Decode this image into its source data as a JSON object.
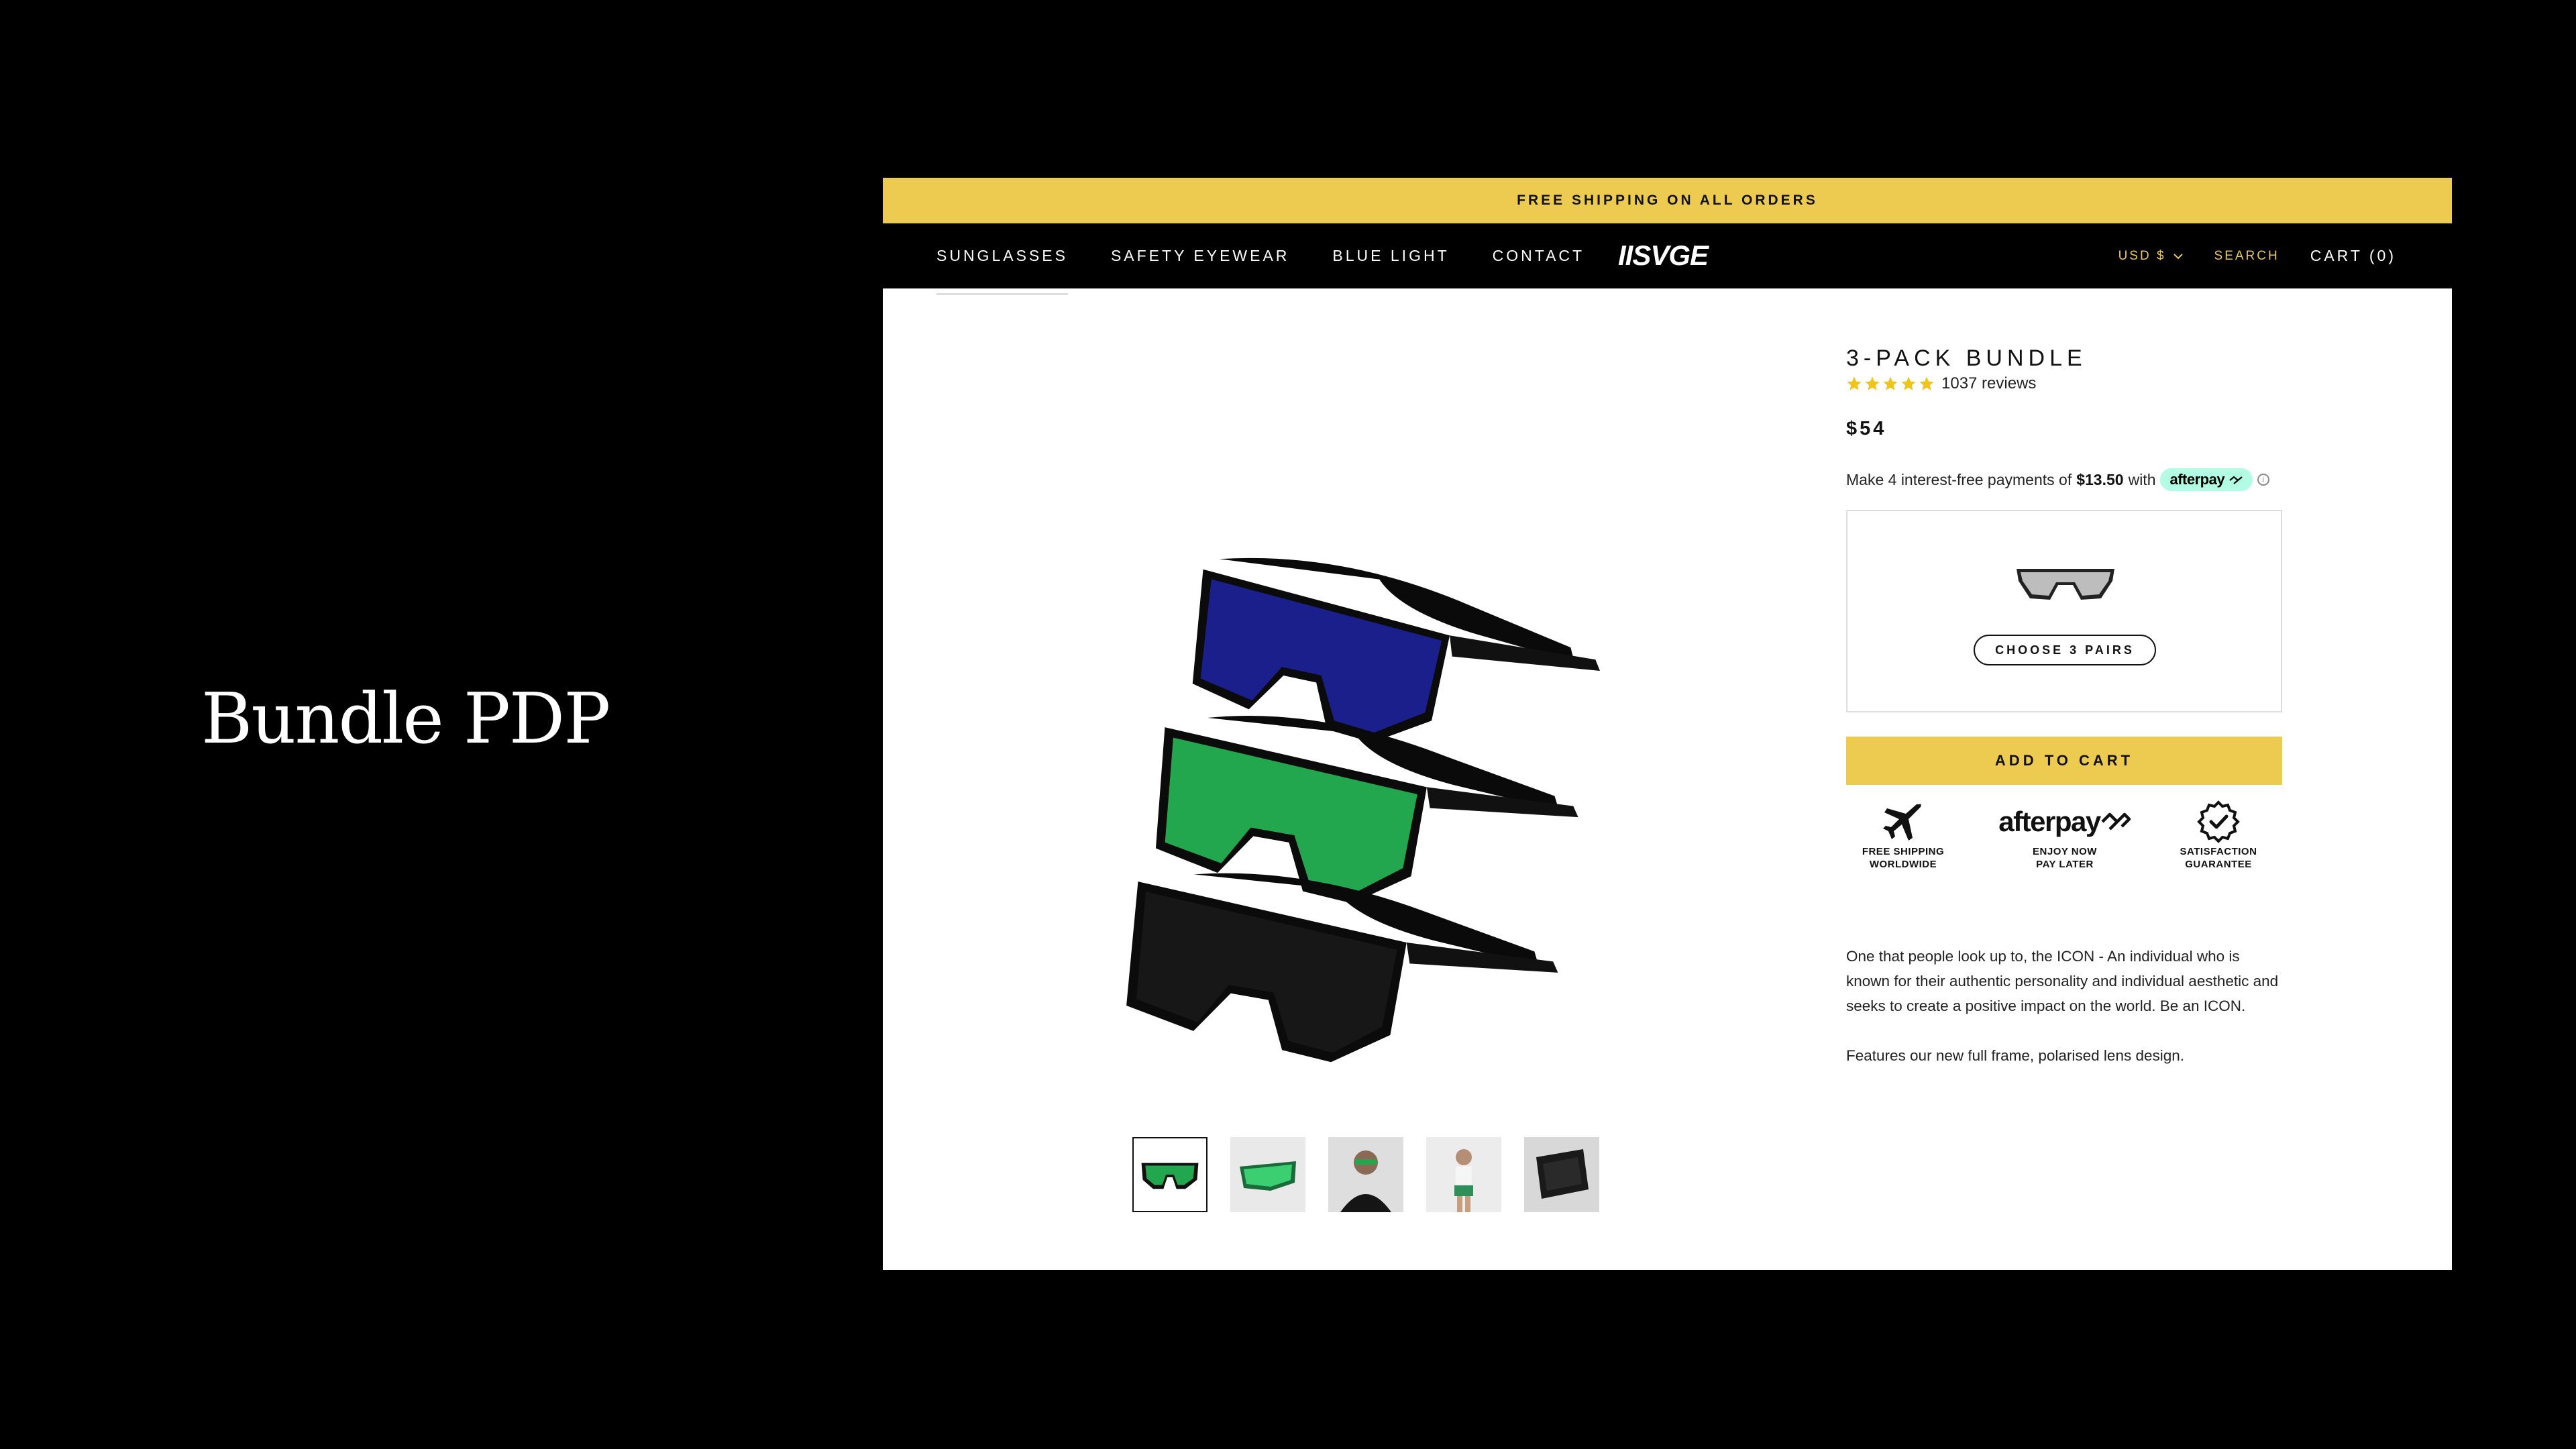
{
  "slide": {
    "title": "Bundle PDP"
  },
  "announcement": "FREE SHIPPING ON ALL ORDERS",
  "nav": {
    "links": [
      "SUNGLASSES",
      "SAFETY EYEWEAR",
      "BLUE LIGHT",
      "CONTACT"
    ],
    "logo": "IISVGE",
    "currency": "USD $",
    "search": "SEARCH",
    "cart": "CART (0)"
  },
  "product": {
    "title": "3-PACK BUNDLE",
    "rating": {
      "stars": 5,
      "reviews": "1037 reviews"
    },
    "price": "$54",
    "installments": {
      "prefix": "Make 4 interest-free payments of",
      "amount": "$13.50",
      "suffix": "with",
      "provider": "afterpay",
      "info": "i"
    },
    "choose_label": "CHOOSE 3 PAIRS",
    "add_to_cart": "ADD TO CART",
    "badges": [
      {
        "icon": "airplane-icon",
        "line1": "FREE SHIPPING",
        "line2": "WORLDWIDE"
      },
      {
        "icon": "afterpay-logo",
        "logo": "afterpay",
        "line1": "ENJOY NOW",
        "line2": "PAY LATER"
      },
      {
        "icon": "checkmark-seal-icon",
        "line1": "SATISFACTION",
        "line2": "GUARANTEE"
      }
    ],
    "description": [
      "One that people look up to, the ICON - An individual who is known for their authentic personality and individual aesthetic and seeks to create a positive impact on the world. Be an ICON.",
      "Features our new full frame, polarised lens design."
    ],
    "thumbnails": [
      "thumb-green-sunglasses",
      "thumb-green-sunglasses-flat",
      "thumb-man-wearing",
      "thumb-woman-wearing",
      "thumb-case"
    ],
    "hero_lens_colors": [
      "#16208c",
      "#1fa84a",
      "#141414"
    ]
  },
  "colors": {
    "accent": "#edcb51",
    "afterpay_mint": "#b2fce4",
    "nav_bg": "#000000"
  }
}
